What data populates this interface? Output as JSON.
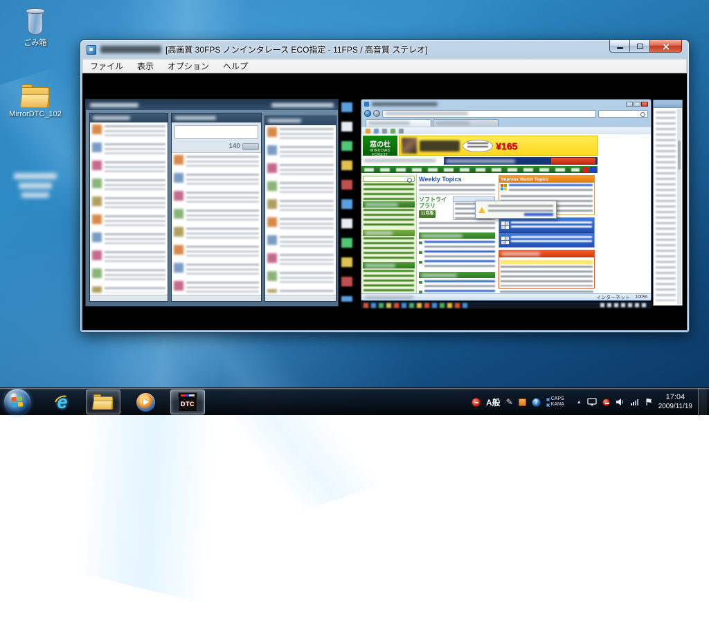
{
  "desktop": {
    "icons": [
      {
        "label": "ごみ箱"
      },
      {
        "label": "MirrorDTC_102"
      }
    ]
  },
  "window": {
    "title": "[高画質 30FPS ノンインタレース ECO指定 - 11FPS / 高音質 ステレオ]",
    "menu": [
      {
        "label": "ファイル"
      },
      {
        "label": "表示"
      },
      {
        "label": "オプション"
      },
      {
        "label": "ヘルプ"
      }
    ]
  },
  "capture": {
    "tweet_counter": "140",
    "browser": {
      "logo": "窓の杜",
      "logo_sub": "WINDOWS FOREST",
      "banner_price": "¥165",
      "weekly_topics": "Weekly Topics",
      "soft_library": "ソフトライブラリ",
      "month_badge": "11月版",
      "watch_topics": "Impress Watch Topics",
      "status_zone": "インターネット",
      "zoom": "100%"
    }
  },
  "taskbar": {
    "dtc_label": "DTC",
    "ime_mode": "A般",
    "caps": "CAPS",
    "kana": "KANA",
    "clock": {
      "time": "17:04",
      "date": "2009/11/19"
    }
  },
  "colors": {
    "accent_green": "#0e8a0e",
    "accent_orange": "#e2760e",
    "close_red": "#c03a22"
  }
}
